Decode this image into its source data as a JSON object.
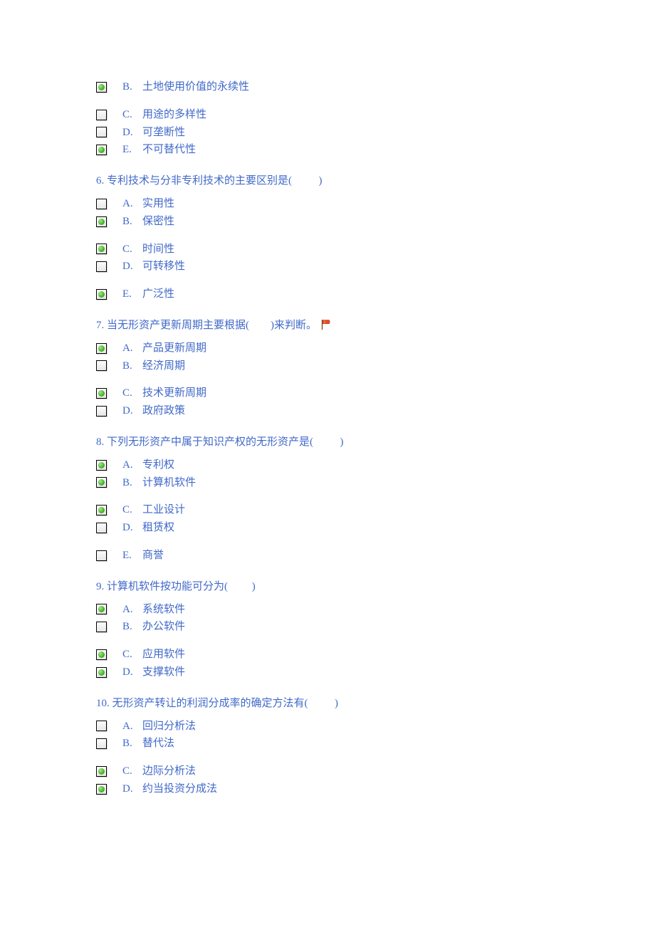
{
  "questions": [
    {
      "stem": "",
      "options": [
        {
          "letter": "B.",
          "text": "土地使用价值的永续性",
          "checked": true,
          "gapAfter": true
        },
        {
          "letter": "C.",
          "text": "用途的多样性",
          "checked": false,
          "gapAfter": false
        },
        {
          "letter": "D.",
          "text": "可垄断性",
          "checked": false,
          "gapAfter": false
        },
        {
          "letter": "E.",
          "text": "不可替代性",
          "checked": true,
          "gapAfter": false
        }
      ]
    },
    {
      "stem": "6. 专利技术与分非专利技术的主要区别是(          )",
      "options": [
        {
          "letter": "A.",
          "text": "实用性",
          "checked": false,
          "gapAfter": false
        },
        {
          "letter": "B.",
          "text": "保密性",
          "checked": true,
          "gapAfter": true
        },
        {
          "letter": "C.",
          "text": "时间性",
          "checked": true,
          "gapAfter": false
        },
        {
          "letter": "D.",
          "text": "可转移性",
          "checked": false,
          "gapAfter": true
        },
        {
          "letter": "E.",
          "text": "广泛性",
          "checked": true,
          "gapAfter": false
        }
      ]
    },
    {
      "stem": "7. 当无形资产更新周期主要根据(        )来判断。",
      "flag": true,
      "options": [
        {
          "letter": "A.",
          "text": "产品更新周期",
          "checked": true,
          "gapAfter": false
        },
        {
          "letter": "B.",
          "text": "经济周期",
          "checked": false,
          "gapAfter": true
        },
        {
          "letter": "C.",
          "text": "技术更新周期",
          "checked": true,
          "gapAfter": false
        },
        {
          "letter": "D.",
          "text": "政府政策",
          "checked": false,
          "gapAfter": false
        }
      ]
    },
    {
      "stem": "8. 下列无形资产中属于知识产权的无形资产是(          )",
      "options": [
        {
          "letter": "A.",
          "text": "专利权",
          "checked": true,
          "gapAfter": false
        },
        {
          "letter": "B.",
          "text": "计算机软件",
          "checked": true,
          "gapAfter": true
        },
        {
          "letter": "C.",
          "text": "工业设计",
          "checked": true,
          "gapAfter": false
        },
        {
          "letter": "D.",
          "text": "租赁权",
          "checked": false,
          "gapAfter": true
        },
        {
          "letter": "E.",
          "text": "商誉",
          "checked": false,
          "gapAfter": false
        }
      ]
    },
    {
      "stem": "9. 计算机软件按功能可分为(         )",
      "options": [
        {
          "letter": "A.",
          "text": "系统软件",
          "checked": true,
          "gapAfter": false
        },
        {
          "letter": "B.",
          "text": "办公软件",
          "checked": false,
          "gapAfter": true
        },
        {
          "letter": "C.",
          "text": "应用软件",
          "checked": true,
          "gapAfter": false
        },
        {
          "letter": "D.",
          "text": "支撑软件",
          "checked": true,
          "gapAfter": false
        }
      ]
    },
    {
      "stem": "10. 无形资产转让的利润分成率的确定方法有(          )",
      "options": [
        {
          "letter": "A.",
          "text": "回归分析法",
          "checked": false,
          "gapAfter": false
        },
        {
          "letter": "B.",
          "text": "替代法",
          "checked": false,
          "gapAfter": true
        },
        {
          "letter": "C.",
          "text": "边际分析法",
          "checked": true,
          "gapAfter": false
        },
        {
          "letter": "D.",
          "text": "约当投资分成法",
          "checked": true,
          "gapAfter": false
        }
      ]
    }
  ]
}
